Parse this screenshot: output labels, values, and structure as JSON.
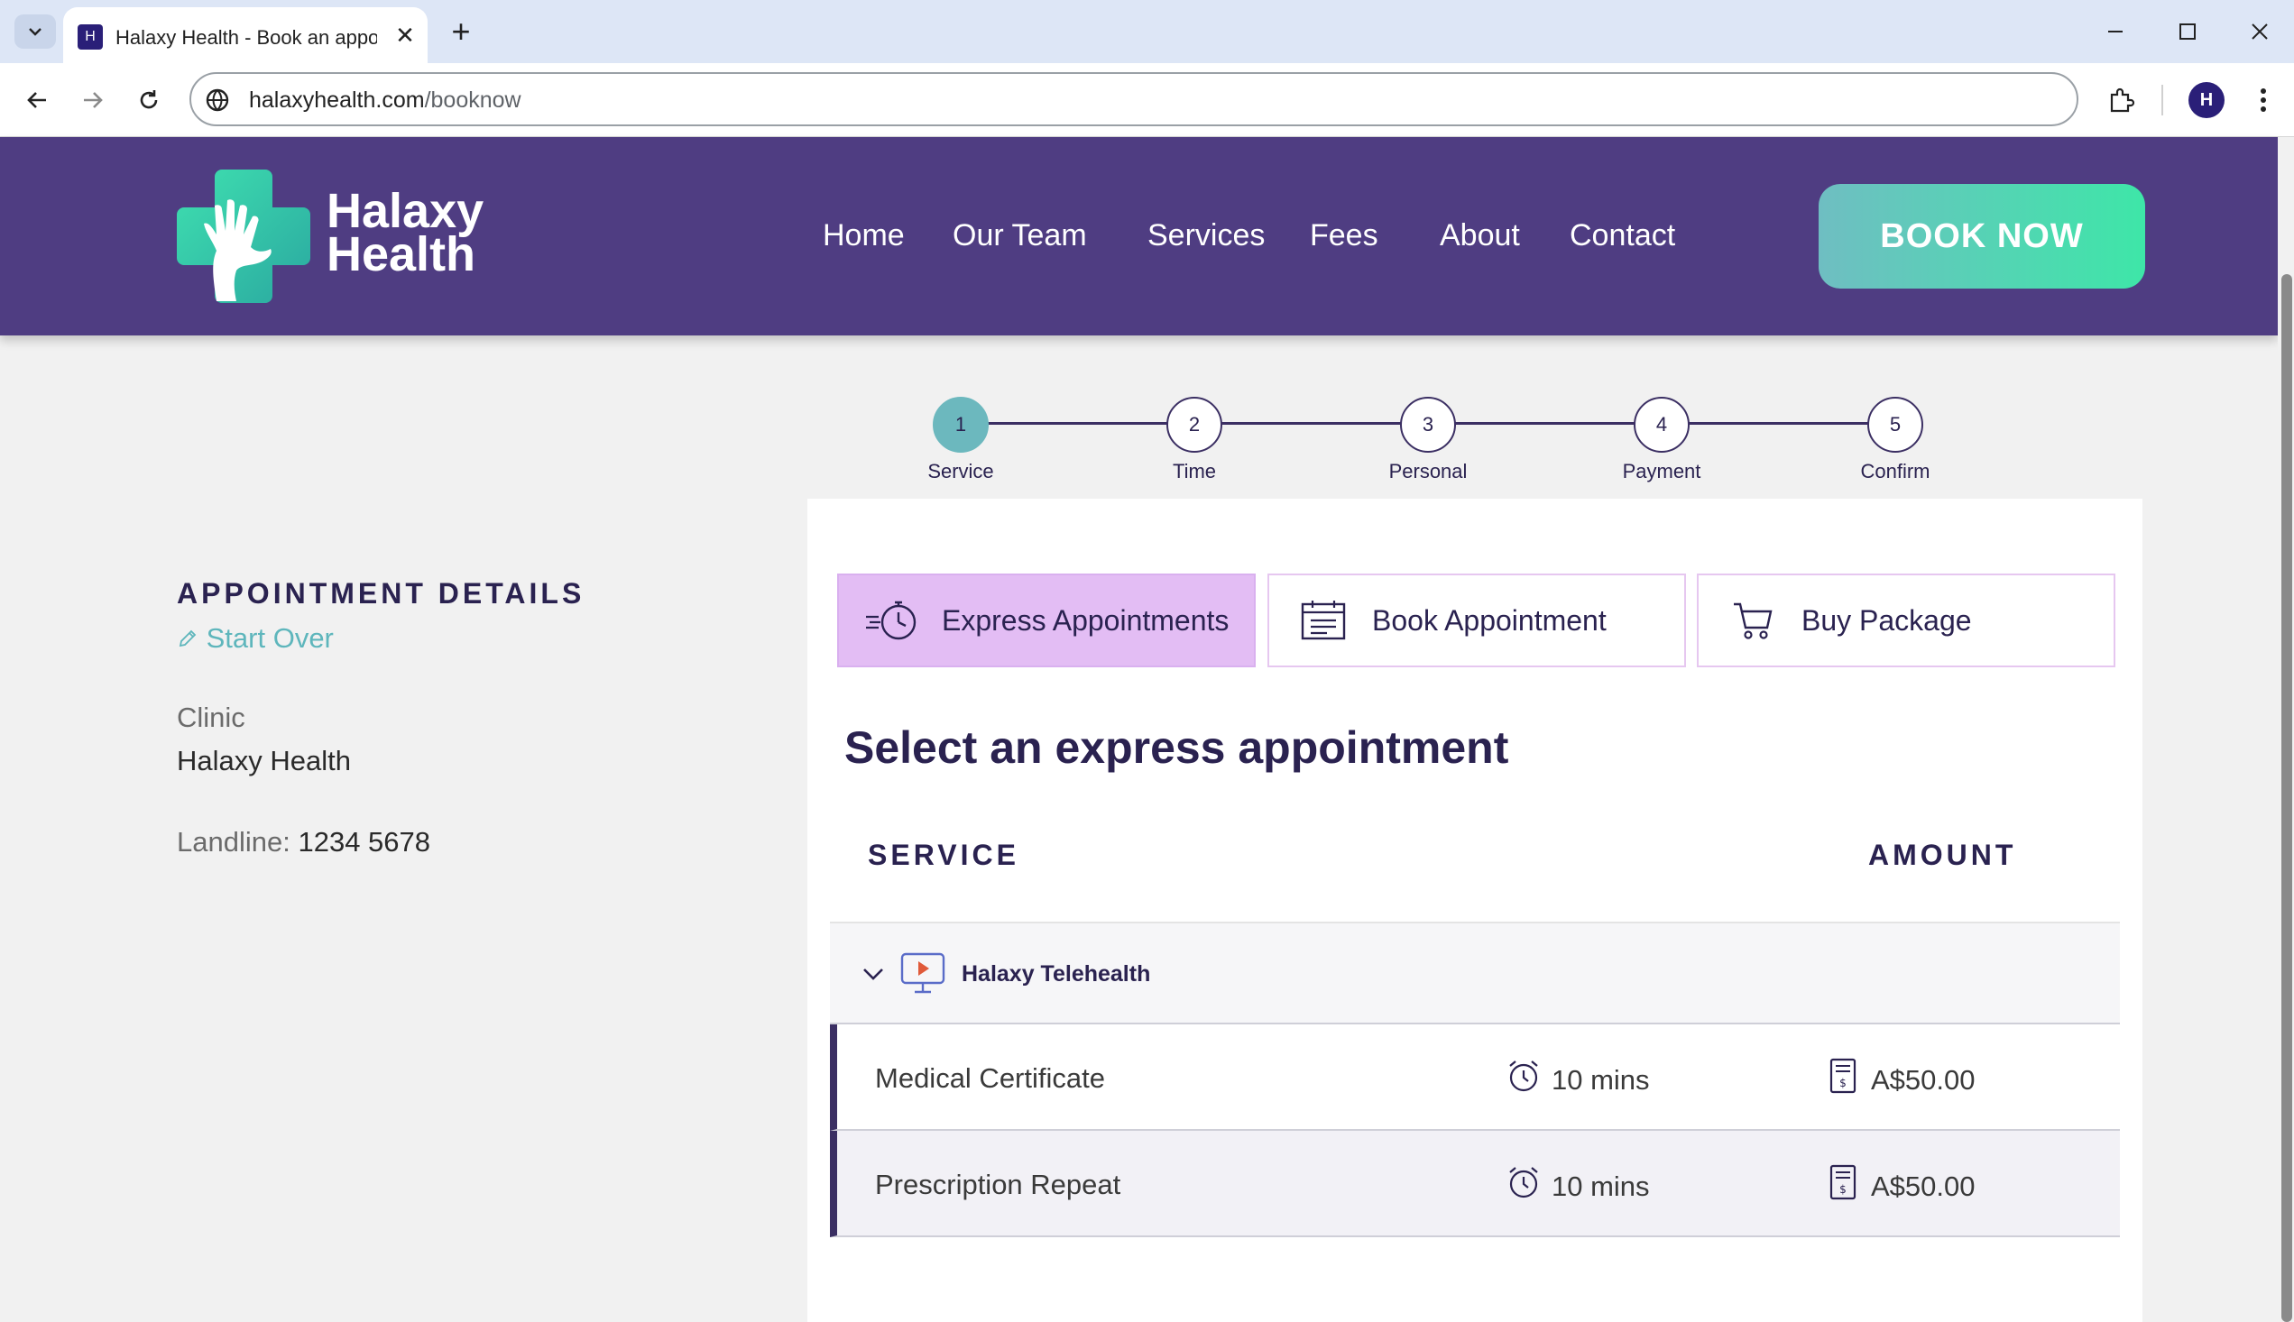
{
  "browser": {
    "tab_title": "Halaxy Health - Book an appointment",
    "url_domain": "halaxyhealth.com",
    "url_path": "/booknow",
    "profile_initial": "H"
  },
  "header": {
    "brand_line1": "Halaxy",
    "brand_line2": "Health",
    "nav": [
      "Home",
      "Our Team",
      "Services",
      "Fees",
      "About",
      "Contact"
    ],
    "cta": "BOOK NOW"
  },
  "stepper": {
    "current": 1,
    "steps": [
      {
        "num": "1",
        "label": "Service"
      },
      {
        "num": "2",
        "label": "Time"
      },
      {
        "num": "3",
        "label": "Personal"
      },
      {
        "num": "4",
        "label": "Payment"
      },
      {
        "num": "5",
        "label": "Confirm"
      }
    ]
  },
  "details": {
    "title": "APPOINTMENT DETAILS",
    "start_over": "Start Over",
    "clinic_label": "Clinic",
    "clinic_value": "Halaxy Health",
    "landline_label": "Landline:",
    "landline_value": "1234 5678"
  },
  "tabs": [
    {
      "label": "Express Appointments",
      "icon": "stopwatch-icon",
      "selected": true
    },
    {
      "label": "Book Appointment",
      "icon": "calendar-icon",
      "selected": false
    },
    {
      "label": "Buy Package",
      "icon": "cart-icon",
      "selected": false
    }
  ],
  "main": {
    "heading": "Select an express appointment",
    "col_service": "SERVICE",
    "col_amount": "AMOUNT",
    "group": "Halaxy Telehealth",
    "services": [
      {
        "name": "Medical Certificate",
        "duration": "10 mins",
        "price": "A$50.00"
      },
      {
        "name": "Prescription Repeat",
        "duration": "10 mins",
        "price": "A$50.00"
      }
    ]
  },
  "colors": {
    "header_bg": "#4f3d82",
    "accent_teal": "#6cb8be",
    "cta_gradient_end": "#3ee6a8",
    "tab_selected": "#e3bdf4",
    "text_dark": "#2a2250"
  }
}
